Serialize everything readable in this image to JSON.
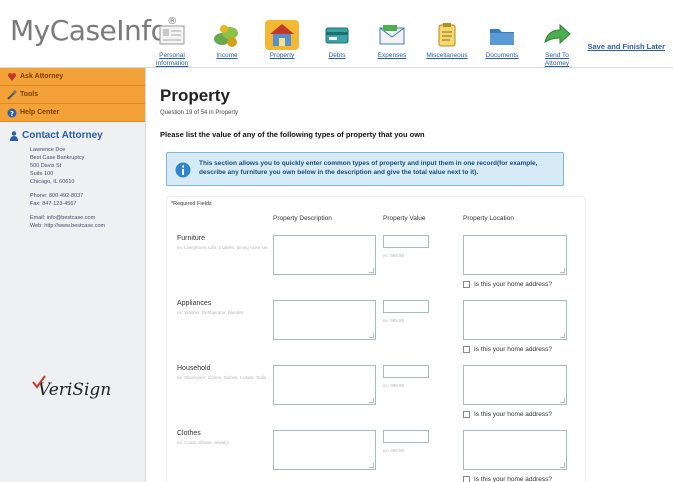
{
  "header": {
    "logo_text": "MyCaseInfo",
    "logo_mark": "®",
    "save_finish_label": "Save and Finish Later",
    "nav": [
      {
        "label": "Personal Information",
        "icon": "personal-information-icon",
        "active": false
      },
      {
        "label": "Income",
        "icon": "income-money-icon",
        "active": false
      },
      {
        "label": "Property",
        "icon": "property-house-icon",
        "active": true
      },
      {
        "label": "Debts",
        "icon": "debts-card-icon",
        "active": false
      },
      {
        "label": "Expenses",
        "icon": "expenses-envelope-icon",
        "active": false
      },
      {
        "label": "Miscellaneous",
        "icon": "miscellaneous-clipboard-icon",
        "active": false
      },
      {
        "label": "Documents",
        "icon": "documents-folder-icon",
        "active": false
      },
      {
        "label": "Send To Attorney",
        "icon": "send-arrow-icon",
        "active": false
      }
    ]
  },
  "sidebar": {
    "buttons": [
      {
        "label": "Ask Attorney",
        "icon": "heart-icon"
      },
      {
        "label": "Tools",
        "icon": "tools-icon"
      },
      {
        "label": "Help Center",
        "icon": "question-icon"
      }
    ],
    "contact_title": "Contact Attorney",
    "address_lines": [
      "Lawrence Doe",
      "Best Case Bankruptcy",
      "500 Davis St",
      "Suite 100",
      "Chicago, IL 60610"
    ],
    "phone_lines": [
      "Phone: 800-492-8037",
      "Fax: 847-123-4567"
    ],
    "web_lines": [
      "Email: info@bestcase.com",
      "Web: http://www.bestcase.com"
    ],
    "verisign_text": "VeriSign"
  },
  "main": {
    "title": "Property",
    "progress": "Question 19 of 54 in Property",
    "instruction": "Please list the value of any of the following types of property that you own",
    "info_text": "This section allows you to quickly enter common types of property and input them in one record(for example, describe any furniture you own below in the description and give the total value next to it).",
    "required_label": "*Required Fields",
    "columns": {
      "description": "Property Description",
      "value": "Property Value",
      "location": "Property Location"
    },
    "value_hint": "ex: 999.99",
    "home_checkbox_label": "Is this your home address?",
    "rows": [
      {
        "label": "Furniture",
        "hint": "ex: Livingroom sofa, 2 tables, dining room set",
        "description": "",
        "value": "",
        "location": "",
        "home": false
      },
      {
        "label": "Appliances",
        "hint": "ex: Washer, Refrigerator, Blender",
        "description": "",
        "value": "",
        "location": "",
        "home": false
      },
      {
        "label": "Household",
        "hint": "ex: Silverware, Linens, Dishes, Lamps, Tools",
        "description": "",
        "value": "",
        "location": "",
        "home": false
      },
      {
        "label": "Clothes",
        "hint": "ex: Coats, Shoes, Jewelry",
        "description": "",
        "value": "",
        "location": "",
        "home": false
      }
    ]
  },
  "colors": {
    "accent_blue": "#2a5ea8",
    "sidebar_orange": "#f3a23a",
    "active_tab": "#f3b733",
    "info_bg": "#d7ebf7"
  }
}
